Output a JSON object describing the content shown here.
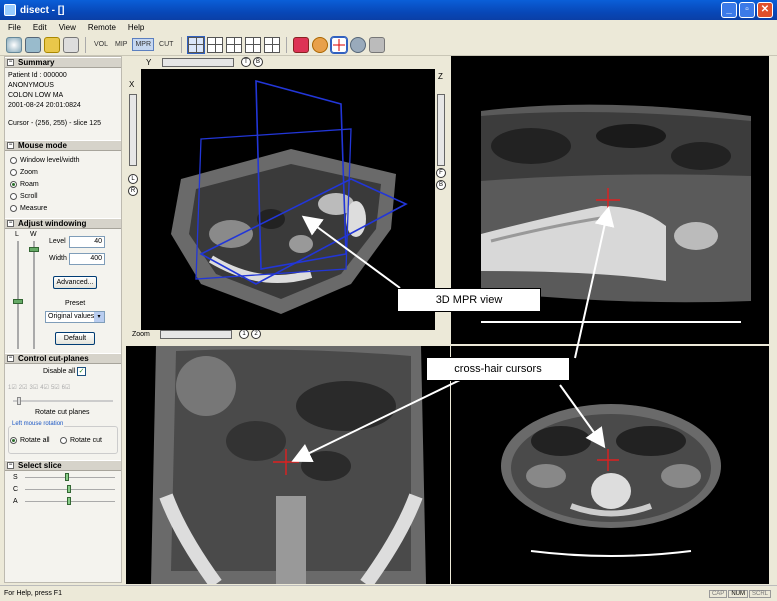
{
  "window": {
    "title": "disect - []"
  },
  "menu": [
    "File",
    "Edit",
    "View",
    "Remote",
    "Help"
  ],
  "toolbar": {
    "vol": "VOL",
    "mip": "MIP",
    "mpr": "MPR",
    "cut": "CUT"
  },
  "summary": {
    "title": "Summary",
    "patient_id": "Patient Id : 000000",
    "name": "ANONYMOUS",
    "study": "COLON LOW MA",
    "datetime": "2001-08-24  20:01:0824",
    "cursor": "Cursor - (256, 255) - slice 125"
  },
  "mouse_mode": {
    "title": "Mouse mode",
    "options": [
      "Window level/width",
      "Zoom",
      "Roam",
      "Scroll",
      "Measure"
    ],
    "selected": "Roam"
  },
  "windowing": {
    "title": "Adjust windowing",
    "l_label": "L",
    "w_label": "W",
    "level_label": "Level",
    "level_value": "40",
    "width_label": "Width",
    "width_value": "400",
    "advanced_button": "Advanced...",
    "preset_label": "Preset",
    "preset_value": "Original values",
    "default_button": "Default"
  },
  "cutplanes": {
    "title": "Control cut-planes",
    "disable_all": "Disable all",
    "checks": [
      "1",
      "2",
      "3",
      "4",
      "5",
      "6"
    ],
    "rotate_label": "Rotate cut planes",
    "group_label": "Left mouse rotation",
    "rotate_all": "Rotate all",
    "rotate_cut": "Rotate cut"
  },
  "select_slice": {
    "title": "Select slice",
    "rows": [
      "S",
      "C",
      "A"
    ]
  },
  "viewport_3d": {
    "y_label": "Y",
    "x_label": "X",
    "z_label": "Z",
    "zoom_label": "Zoom",
    "btn_t": "T",
    "btn_b": "B",
    "btn_l": "L",
    "btn_r": "R",
    "btn_f": "F",
    "btn_b2": "B",
    "btn_1": "1",
    "btn_2": "2"
  },
  "callouts": {
    "mpr": "3D MPR view",
    "crosshair": "cross-hair cursors"
  },
  "status": {
    "text": "For Help, press F1",
    "cap": "CAP",
    "num": "NUM",
    "scrl": "SCRL"
  }
}
